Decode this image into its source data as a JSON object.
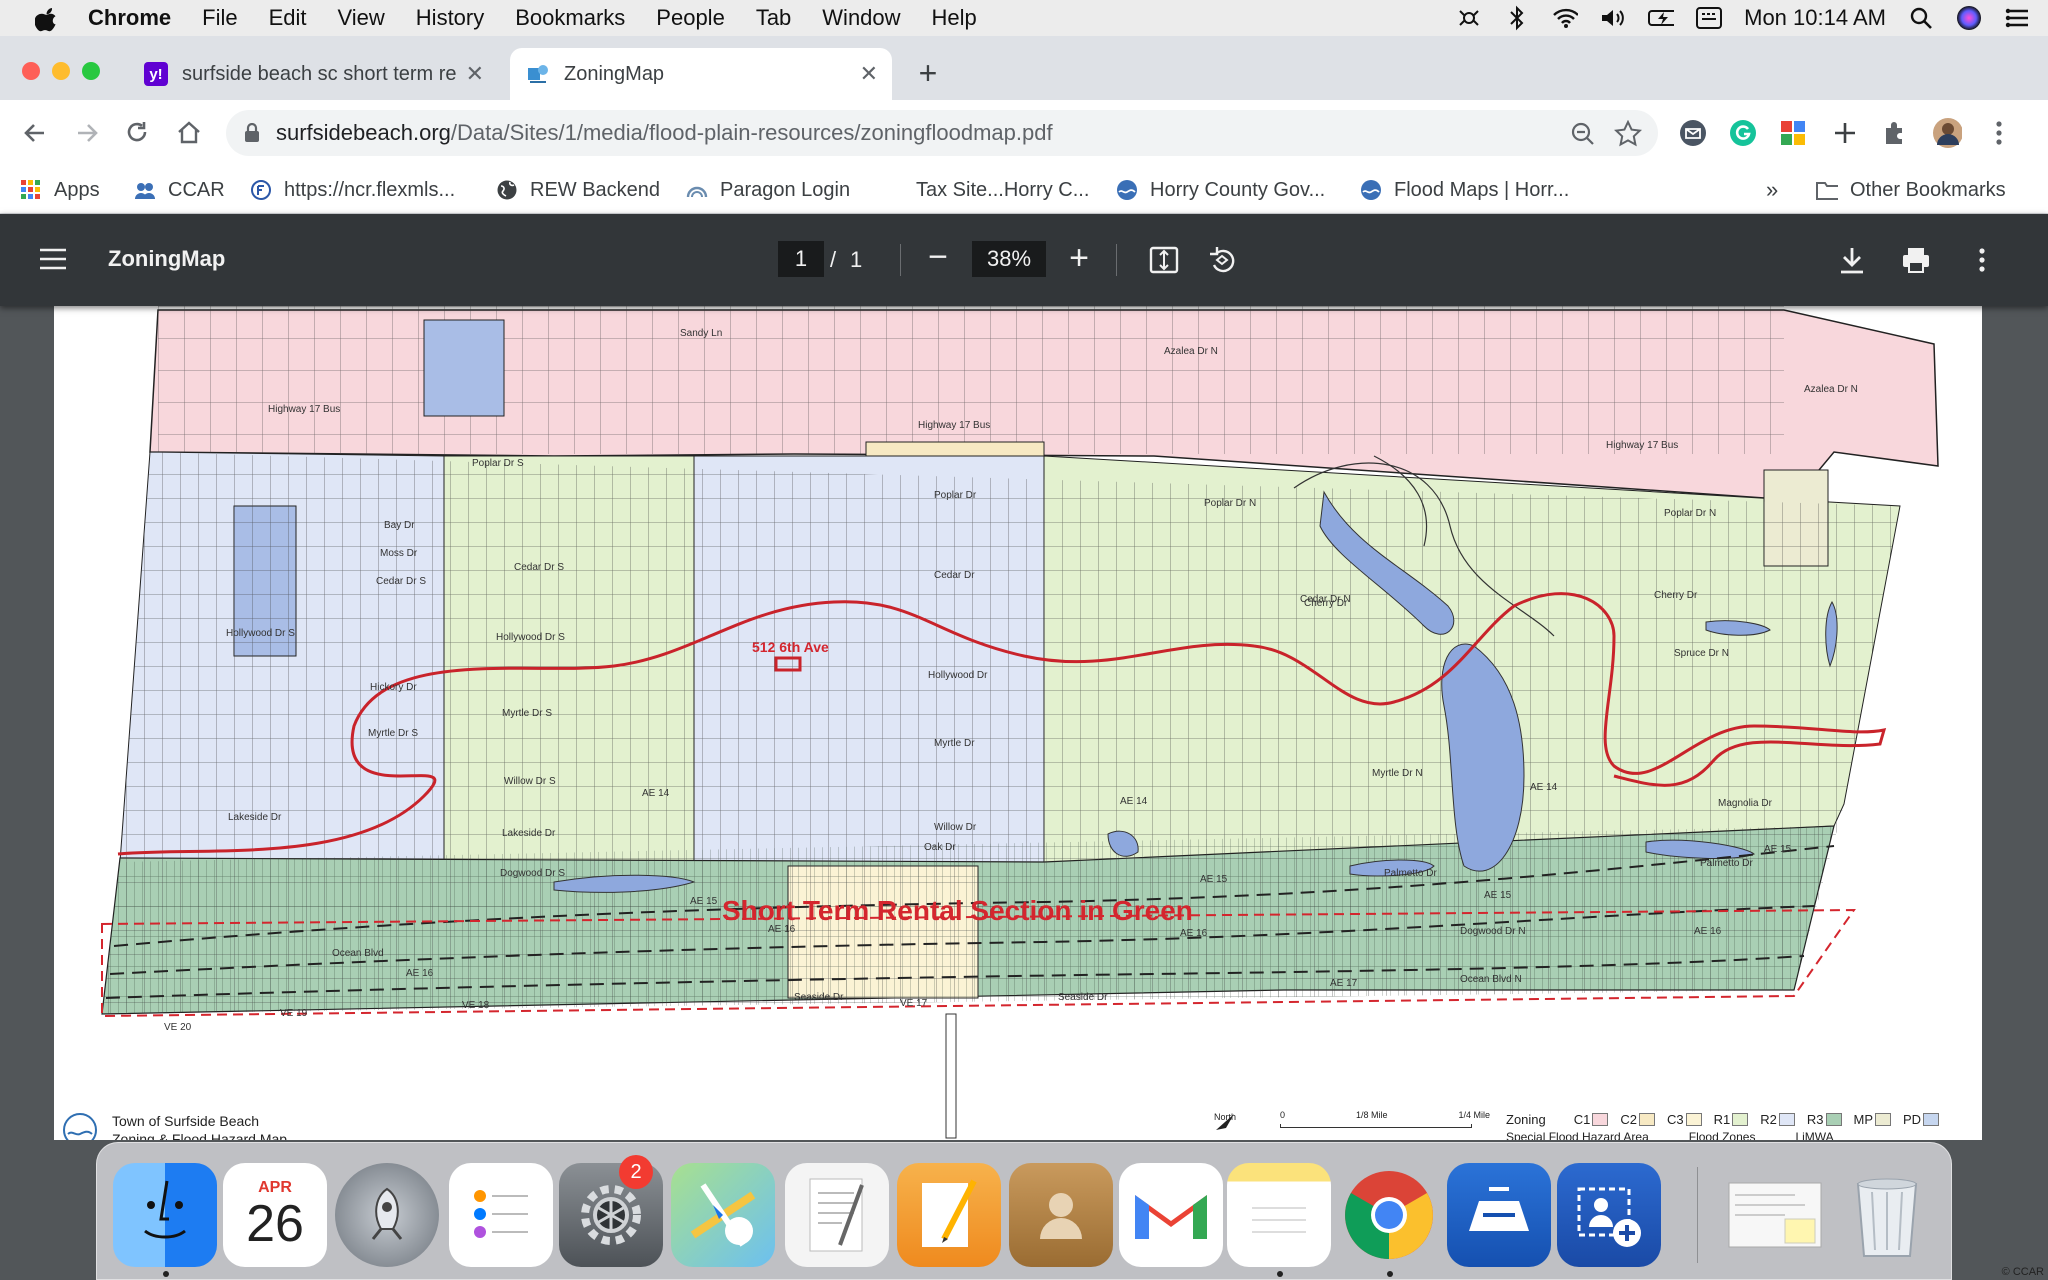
{
  "menubar": {
    "app_name": "Chrome",
    "items": [
      "File",
      "Edit",
      "View",
      "History",
      "Bookmarks",
      "People",
      "Tab",
      "Window",
      "Help"
    ],
    "clock": "Mon 10:14 AM",
    "status_icons": [
      "screenshot-tool-icon",
      "bluetooth-icon",
      "wifi-icon",
      "volume-icon",
      "battery-icon",
      "keyboard-icon",
      "spotlight-icon",
      "siri-icon",
      "control-center-icon"
    ]
  },
  "tabs": [
    {
      "title": "surfside beach sc short term re",
      "favicon": "y!",
      "favicon_color": "#6001d2",
      "active": false
    },
    {
      "title": "ZoningMap",
      "favicon": "zoning-favicon",
      "favicon_color": "#3a8fd1",
      "active": true
    }
  ],
  "omnibox": {
    "host": "surfsidebeach.org",
    "path": "/Data/Sites/1/media/flood-plain-resources/zoningfloodmap.pdf"
  },
  "bookmarks": [
    {
      "label": "Apps",
      "icon": "apps-grid-icon"
    },
    {
      "label": "CCAR",
      "icon": "ccar-icon"
    },
    {
      "label": "https://ncr.flexmls...",
      "icon": "flexmls-icon"
    },
    {
      "label": "REW Backend",
      "icon": "globe-icon"
    },
    {
      "label": "Paragon Login",
      "icon": "paragon-icon"
    },
    {
      "label": "Tax Site...Horry C...",
      "icon": ""
    },
    {
      "label": "Horry County Gov...",
      "icon": "horry-county-icon"
    },
    {
      "label": "Flood Maps | Horr...",
      "icon": "horry-county-icon"
    },
    {
      "label": "Other Bookmarks",
      "icon": "folder-icon"
    }
  ],
  "pdf": {
    "title": "ZoningMap",
    "page_current": "1",
    "page_separator": "/",
    "page_total": "1",
    "zoom": "38%"
  },
  "map": {
    "annotation_address": "512 6th Ave",
    "annotation_section": "Short Term Rental Section in Green",
    "title_line1": "Town of Surfside Beach",
    "title_line2": "Zoning & Flood Hazard Map",
    "streets": [
      "Highway 17 Bus",
      "Sandy Ln",
      "Azalea Dr N",
      "Poplar Dr S",
      "Poplar Dr",
      "Poplar Dr N",
      "Bay Dr",
      "Moss Dr",
      "Cedar Dr S",
      "Cedar Dr",
      "Cedar Dr N",
      "Hollywood Dr S",
      "Hollywood Dr",
      "Hickory Dr",
      "Myrtle Dr S",
      "Myrtle Dr",
      "Myrtle Dr N",
      "Willow Dr S",
      "Willow Dr",
      "Lakeside Dr",
      "Oak Dr",
      "Dogwood Dr S",
      "Dogwood Dr N",
      "Ocean Blvd",
      "Ocean Blvd N",
      "Seaside Dr",
      "Cherry Dr",
      "Spruce Dr N",
      "Magnolia Dr",
      "Palmetto Dr",
      "Azalea Dr N"
    ],
    "flood_labels": [
      "AE 14",
      "AE 15",
      "AE 16",
      "AE 17",
      "VE 17",
      "VE 18",
      "VE 19",
      "VE 20"
    ],
    "north_label": "North",
    "scale_labels": [
      "0",
      "1/8 Mile",
      "1/4 Mile"
    ],
    "legend": {
      "zoning_label": "Zoning",
      "items": [
        {
          "code": "C1",
          "color": "#f8d7dc"
        },
        {
          "code": "C2",
          "color": "#f7e9c3"
        },
        {
          "code": "C3",
          "color": "#fbf3d5"
        },
        {
          "code": "R1",
          "color": "#e3f1cf"
        },
        {
          "code": "R2",
          "color": "#dfe6f6"
        },
        {
          "code": "R3",
          "color": "#a9cfb4"
        },
        {
          "code": "MP",
          "color": "#ecebd2"
        },
        {
          "code": "PD",
          "color": "#c6d6ef"
        }
      ],
      "row2": [
        "Special Flood Hazard Area",
        "Flood Zones",
        "LiMWA"
      ]
    }
  },
  "dock": [
    {
      "name": "finder",
      "color": "#2b8ff5",
      "running": true
    },
    {
      "name": "calendar",
      "color": "#ffffff",
      "month": "APR",
      "day": "26",
      "running": false
    },
    {
      "name": "launchpad",
      "color": "#9aa2ab",
      "running": false
    },
    {
      "name": "reminders",
      "color": "#ffffff",
      "running": false
    },
    {
      "name": "system-preferences",
      "color": "#6f7478",
      "badge": "2",
      "running": false
    },
    {
      "name": "maps",
      "color": "#8fd17a",
      "running": false
    },
    {
      "name": "textedit",
      "color": "#f4f4f4",
      "running": false
    },
    {
      "name": "pages",
      "color": "#f39b2d",
      "running": false
    },
    {
      "name": "contacts",
      "color": "#b9894c",
      "running": false
    },
    {
      "name": "gmail",
      "color": "#ffffff",
      "running": false
    },
    {
      "name": "notes",
      "color": "#fff6b0",
      "running": true
    },
    {
      "name": "chrome",
      "color": "#ffffff",
      "running": true
    },
    {
      "name": "image-capture",
      "color": "#1a61c8",
      "running": false
    },
    {
      "name": "screenshot-app",
      "color": "#1f5fc0",
      "running": false
    }
  ],
  "copyright": "© CCAR"
}
